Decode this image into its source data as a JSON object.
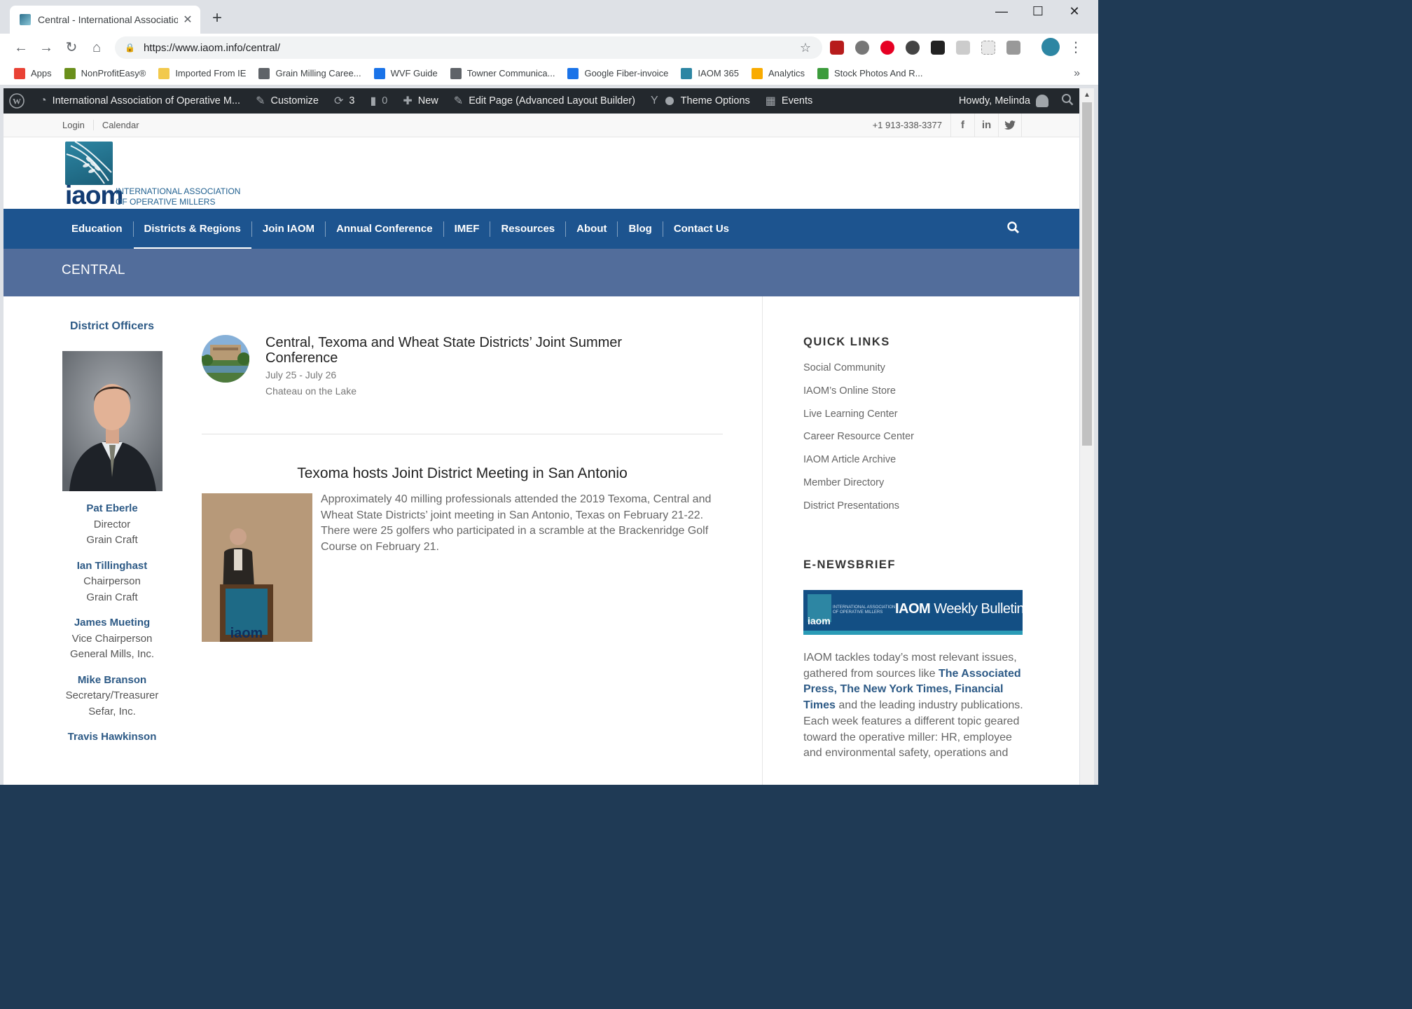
{
  "browser": {
    "tab_title": "Central - International Associatio",
    "url": "https://www.iaom.info/central/",
    "bookmarks": [
      {
        "label": "Apps",
        "icon": "apps-grid-icon",
        "color": "#e94235"
      },
      {
        "label": "NonProfitEasy®",
        "icon": "nonprofiteasy-icon",
        "color": "#6a8f1b"
      },
      {
        "label": "Imported From IE",
        "icon": "folder-icon",
        "color": "#f2c94c"
      },
      {
        "label": "Grain Milling Caree...",
        "icon": "globe-icon",
        "color": "#5f6368"
      },
      {
        "label": "WVF Guide",
        "icon": "wvf-icon",
        "color": "#1a73e8"
      },
      {
        "label": "Towner Communica...",
        "icon": "globe-icon",
        "color": "#5f6368"
      },
      {
        "label": "Google Fiber-invoice",
        "icon": "fiber-icon",
        "color": "#1a73e8"
      },
      {
        "label": "IAOM 365",
        "icon": "iaom-icon",
        "color": "#2d86a3"
      },
      {
        "label": "Analytics",
        "icon": "analytics-icon",
        "color": "#f9ab00"
      },
      {
        "label": "Stock Photos And R...",
        "icon": "stock-photos-icon",
        "color": "#3c9c3c"
      }
    ]
  },
  "adminbar": {
    "site_name": "International Association of Operative M...",
    "customize": "Customize",
    "updates": "3",
    "comments": "0",
    "new": "New",
    "edit_page": "Edit Page (Advanced Layout Builder)",
    "theme_options": "Theme Options",
    "events": "Events",
    "howdy": "Howdy, Melinda"
  },
  "topbar": {
    "login": "Login",
    "calendar": "Calendar",
    "phone": "+1 913-338-3377"
  },
  "logo": {
    "wordmark": "iaom",
    "line1": "INTERNATIONAL ASSOCIATION",
    "line2": "OF OPERATIVE MILLERS"
  },
  "nav": {
    "items": [
      "Education",
      "Districts & Regions",
      "Join IAOM",
      "Annual Conference",
      "IMEF",
      "Resources",
      "About",
      "Blog",
      "Contact Us"
    ]
  },
  "page_title": "CENTRAL",
  "officers": {
    "heading": "District Officers",
    "list": [
      {
        "name": "Pat Eberle",
        "role": "Director",
        "company": "Grain Craft"
      },
      {
        "name": "Ian Tillinghast",
        "role": "Chairperson",
        "company": "Grain Craft"
      },
      {
        "name": "James Mueting",
        "role": "Vice Chairperson",
        "company": "General Mills, Inc."
      },
      {
        "name": "Mike Branson",
        "role": "Secretary/Treasurer",
        "company": "Sefar, Inc."
      },
      {
        "name": "Travis Hawkinson",
        "role": "",
        "company": ""
      }
    ]
  },
  "event": {
    "title": "Central, Texoma and Wheat State Districts’ Joint Summer Conference",
    "dates": "July 25 - July 26",
    "location": "Chateau on the Lake"
  },
  "news": {
    "title": "Texoma hosts Joint District Meeting in San Antonio",
    "body": "Approximately 40 milling professionals attended the 2019 Texoma, Central and Wheat State Districts’ joint meeting in San Antonio, Texas on February 21-22. There were 25 golfers who participated in a scramble at the Brackenridge Golf Course on February 21."
  },
  "quick_links": {
    "heading": "QUICK LINKS",
    "items": [
      "Social Community",
      "IAOM’s Online Store",
      "Live Learning Center",
      "Career Resource Center",
      "IAOM Article Archive",
      "Member Directory",
      "District Presentations"
    ]
  },
  "enewsbrief": {
    "heading": "E-NEWSBRIEF",
    "banner_brand": "IAOM",
    "banner_title": "Weekly Bulletin",
    "banner_small_1": "INTERNATIONAL ASSOCIATION",
    "banner_small_2": "OF OPERATIVE MILLERS",
    "banner_wordmark": "iaom",
    "text_1": "IAOM tackles today’s most relevant issues, gathered from sources like ",
    "sources": "The Associated Press, The New York Times, Financial Times",
    "text_2": " and the leading industry publications. Each week features a different topic geared toward the operative miller: HR, employee and environmental safety, operations and"
  },
  "colors": {
    "nav_blue": "#1d548f",
    "title_bar": "#526d9b",
    "link_blue": "#2d5a86",
    "admin_bar": "#23282d"
  }
}
